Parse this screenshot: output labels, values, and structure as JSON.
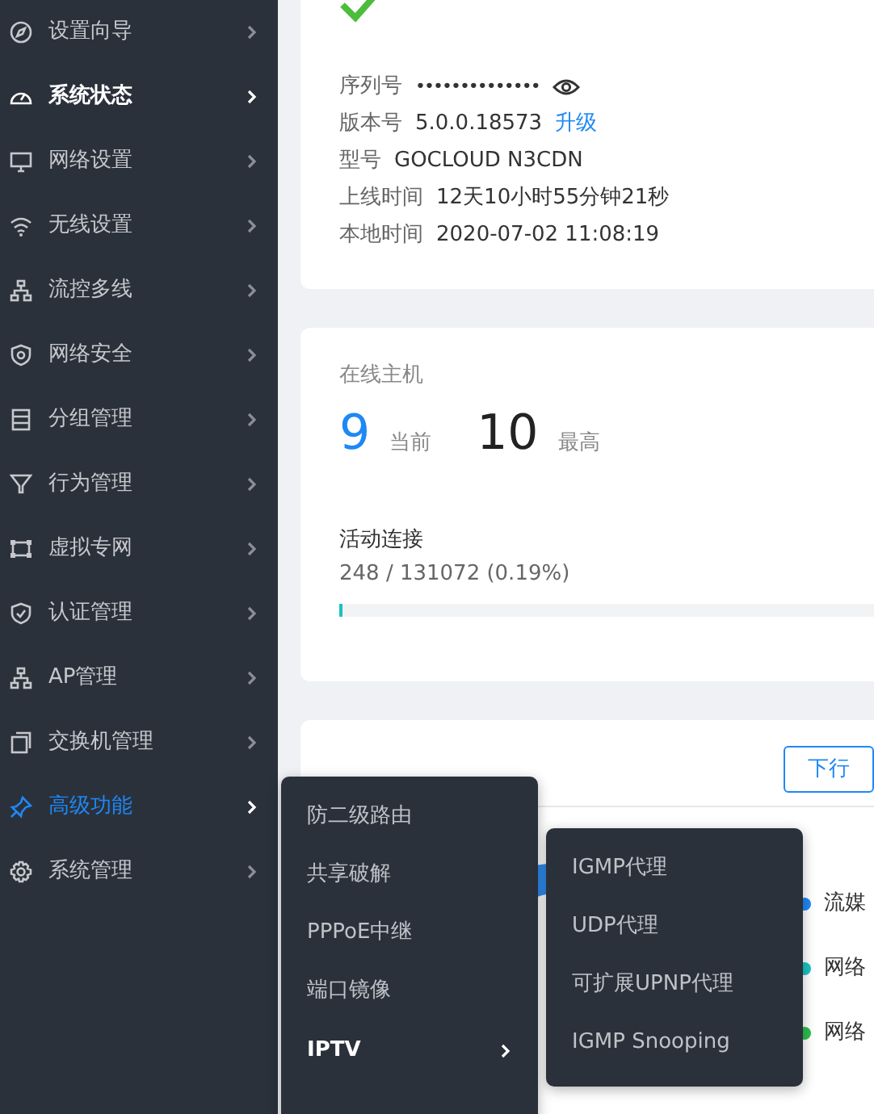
{
  "sidebar": {
    "items": [
      {
        "label": "设置向导",
        "selected": false
      },
      {
        "label": "系统状态",
        "selected": true
      },
      {
        "label": "网络设置",
        "selected": false
      },
      {
        "label": "无线设置",
        "selected": false
      },
      {
        "label": "流控多线",
        "selected": false
      },
      {
        "label": "网络安全",
        "selected": false
      },
      {
        "label": "分组管理",
        "selected": false
      },
      {
        "label": "行为管理",
        "selected": false
      },
      {
        "label": "虚拟专网",
        "selected": false
      },
      {
        "label": "认证管理",
        "selected": false
      },
      {
        "label": "AP管理",
        "selected": false
      },
      {
        "label": "交换机管理",
        "selected": false
      },
      {
        "label": "高级功能",
        "selected": false,
        "open": true
      },
      {
        "label": "系统管理",
        "selected": false
      }
    ]
  },
  "device_info": [
    {
      "label": "序列号",
      "value": "••••••••••••••",
      "kind": "secret"
    },
    {
      "label": "版本号",
      "value": "5.0.0.18573",
      "link": "升级",
      "kind": "link"
    },
    {
      "label": "型号",
      "value": "GOCLOUD N3CDN",
      "kind": "plain"
    },
    {
      "label": "上线时间",
      "value": "12天10小时55分钟21秒",
      "kind": "plain"
    },
    {
      "label": "本地时间",
      "value": "2020-07-02 11:08:19",
      "kind": "plain"
    }
  ],
  "online_hosts": {
    "title": "在线主机",
    "current": "9",
    "current_label": "当前",
    "max": "10",
    "max_label": "最高"
  },
  "active_connections": {
    "title": "活动连接",
    "reading": "248 / 131072 (0.19%)",
    "level": 0.0019
  },
  "traffic": {
    "button": "下行",
    "legend": [
      {
        "label": "流媒",
        "color": "#1e88f5"
      },
      {
        "label": "网络",
        "color": "#19c2c2"
      },
      {
        "label": "网络",
        "color": "#2dbd4e"
      }
    ]
  },
  "flyout_menu": [
    {
      "label": "防二级路由",
      "has_submenu": false,
      "selected": false
    },
    {
      "label": "共享破解",
      "has_submenu": false,
      "selected": false
    },
    {
      "label": "PPPoE中继",
      "has_submenu": false,
      "selected": false
    },
    {
      "label": "端口镜像",
      "has_submenu": false,
      "selected": false
    },
    {
      "label": "IPTV",
      "has_submenu": true,
      "selected": true
    }
  ],
  "submenu": [
    "IGMP代理",
    "UDP代理",
    "可扩展UPNP代理",
    "IGMP Snooping"
  ]
}
